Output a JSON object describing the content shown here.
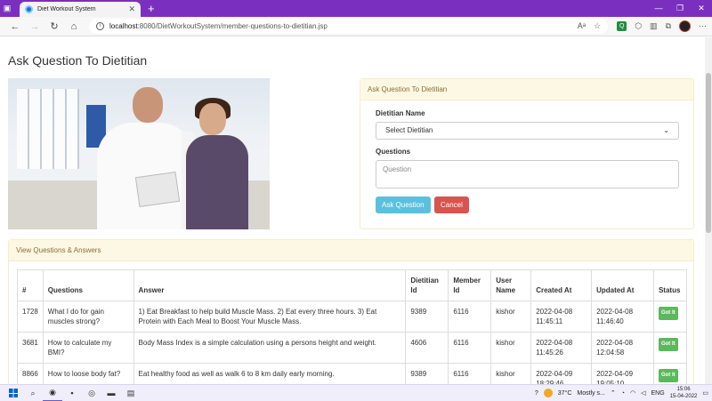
{
  "browser": {
    "tab_title": "Diet Workout System",
    "url_host": "localhost",
    "url_path": ":8080/DietWorkoutSystem/member-questions-to-dietitian.jsp",
    "window_buttons": [
      "—",
      "❐",
      "✕"
    ]
  },
  "page": {
    "title": "Ask Question To Dietitian"
  },
  "ask_form": {
    "heading": "Ask Question To Dietitian",
    "dietitian_label": "Dietitian Name",
    "dietitian_selected": "Select Dietitian",
    "questions_label": "Questions",
    "questions_placeholder": "Question",
    "submit_label": "Ask Question",
    "cancel_label": "Cancel"
  },
  "qa": {
    "heading": "View Questions & Answers",
    "columns": [
      "#",
      "Questions",
      "Answer",
      "Dietitian Id",
      "Member Id",
      "User Name",
      "Created At",
      "Updated At",
      "Status"
    ],
    "rows": [
      {
        "id": "1728",
        "question": "What I do for gain muscles strong?",
        "answer": "1) Eat Breakfast to help build Muscle Mass. 2) Eat every three hours. 3) Eat Protein with Each Meal to Boost Your Muscle Mass.",
        "dietitian_id": "9389",
        "member_id": "6116",
        "user_name": "kishor",
        "created_at": "2022-04-08 11:45:11",
        "updated_at": "2022-04-08 11:46:40",
        "status": "Got It"
      },
      {
        "id": "3681",
        "question": "How to calculate my BMI?",
        "answer": "Body Mass Index is a simple calculation using a persons height and weight.",
        "dietitian_id": "4606",
        "member_id": "6116",
        "user_name": "kishor",
        "created_at": "2022-04-08 11:45:26",
        "updated_at": "2022-04-08 12:04:58",
        "status": "Got It"
      },
      {
        "id": "8866",
        "question": "How to loose body fat?",
        "answer": "Eat healthy food as well as walk 6 to 8 km daily early morning.",
        "dietitian_id": "9389",
        "member_id": "6116",
        "user_name": "kishor",
        "created_at": "2022-04-09 18:29:46",
        "updated_at": "2022-04-09 19:05:10",
        "status": "Got It"
      }
    ]
  },
  "taskbar": {
    "temperature": "37°C",
    "weather": "Mostly s...",
    "language": "ENG",
    "time": "15:06",
    "date": "15-04-2022"
  }
}
